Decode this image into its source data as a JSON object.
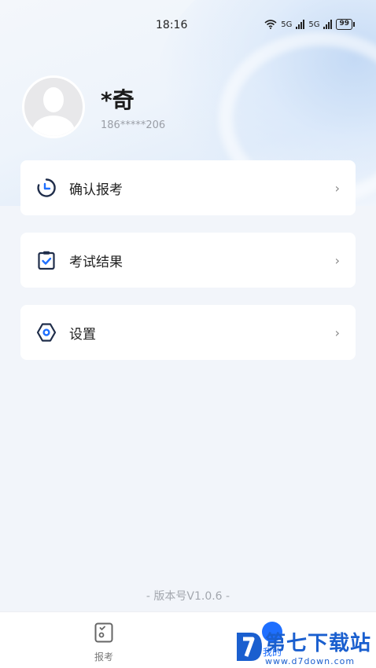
{
  "status_bar": {
    "time": "18:16",
    "network_1": "5G",
    "network_2": "5G",
    "battery": "99"
  },
  "profile": {
    "name": "*奇",
    "phone": "186*****206"
  },
  "menu": [
    {
      "label": "确认报考",
      "icon": "clock-icon"
    },
    {
      "label": "考试结果",
      "icon": "clipboard-check-icon"
    },
    {
      "label": "设置",
      "icon": "hexagon-settings-icon"
    }
  ],
  "chevron": "›",
  "version": "- 版本号V1.0.6 -",
  "tabbar": {
    "tabs": [
      {
        "label": "报考",
        "icon": "exam-icon",
        "active": false
      },
      {
        "label": "我的",
        "icon": "profile-dot-icon",
        "active": true
      }
    ]
  },
  "watermark": {
    "main": "第七下载站",
    "sub": "www.d7down.com"
  },
  "colors": {
    "accent": "#1e6fff",
    "icon_dark": "#1f2d4a",
    "card_bg": "#ffffff",
    "page_bg": "#f2f5fa"
  }
}
